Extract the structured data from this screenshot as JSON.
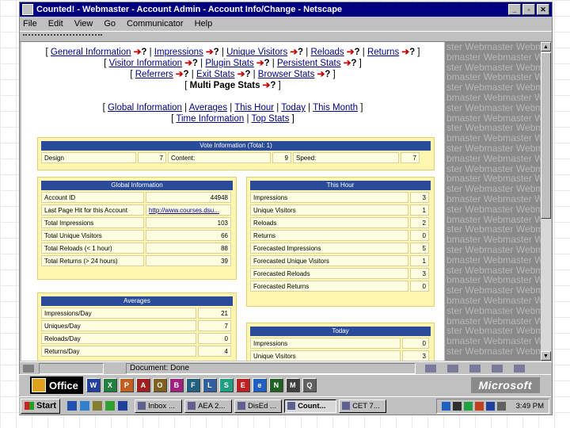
{
  "window": {
    "title": "Counted! - Webmaster - Account Admin - Account Info/Change - Netscape",
    "min_icon": "minimize-icon",
    "max_icon": "maximize-icon",
    "close_icon": "close-icon"
  },
  "menubar": [
    "File",
    "Edit",
    "View",
    "Go",
    "Communicator",
    "Help"
  ],
  "nav": {
    "row1": [
      "General Information",
      "Impressions",
      "Unique Visitors",
      "Reloads",
      "Returns"
    ],
    "row2": [
      "Visitor Information",
      "Plugin Stats",
      "Persistent Stats"
    ],
    "row3": [
      "Referrers",
      "Exit Stats",
      "Browser Stats"
    ],
    "row4_current": "Multi Page Stats",
    "row5": [
      "Global Information",
      "Averages",
      "This Hour",
      "Today",
      "This Month"
    ],
    "row6": [
      "Time Information",
      "Top Stats"
    ]
  },
  "vote": {
    "header": "Vote Information (Total: 1)",
    "cells": [
      {
        "label": "Design",
        "value": "7"
      },
      {
        "label": "Content:",
        "value": "9"
      },
      {
        "label": "Speed:",
        "value": "7"
      }
    ]
  },
  "global_info": {
    "header": "Global Information",
    "rows": [
      {
        "label": "Account ID",
        "value": "44948"
      },
      {
        "label": "Last Page Hit for this Account",
        "value": "http://www.courses.dsu..."
      },
      {
        "label": "Total Impressions",
        "value": "103"
      },
      {
        "label": "Total Unique Visitors",
        "value": "66"
      },
      {
        "label": "Total Reloads (< 1 hour)",
        "value": "88"
      },
      {
        "label": "Total Returns (> 24 hours)",
        "value": "39"
      }
    ]
  },
  "this_hour": {
    "header": "This Hour",
    "rows": [
      {
        "label": "Impressions",
        "value": "3"
      },
      {
        "label": "Unique Visitors",
        "value": "1"
      },
      {
        "label": "Reloads",
        "value": "2"
      },
      {
        "label": "Returns",
        "value": "0"
      },
      {
        "label": "Forecasted Impressions",
        "value": "5"
      },
      {
        "label": "Forecasted Unique Visitors",
        "value": "1"
      },
      {
        "label": "Forecasted Reloads",
        "value": "3"
      },
      {
        "label": "Forecasted Returns",
        "value": "0"
      }
    ]
  },
  "averages": {
    "header": "Averages",
    "rows": [
      {
        "label": "Impressions/Day",
        "value": "21"
      },
      {
        "label": "Uniques/Day",
        "value": "7"
      },
      {
        "label": "Reloads/Day",
        "value": "0"
      },
      {
        "label": "Returns/Day",
        "value": "4"
      }
    ]
  },
  "today": {
    "header": "Today",
    "rows": [
      {
        "label": "Impressions",
        "value": "0"
      },
      {
        "label": "Unique Visitors",
        "value": "3"
      }
    ]
  },
  "sidebar_watermark": "Webmaster",
  "status": {
    "text": "Document: Done"
  },
  "office": {
    "label": "Office",
    "brand": "Microsoft"
  },
  "taskbar": {
    "start": "Start",
    "tasks": [
      "Inbox ...",
      "AEA 2...",
      "DisEd ...",
      "Count...",
      "CET 7..."
    ],
    "active_task": "Count...",
    "clock": "3:49 PM"
  },
  "colors": {
    "titlebar": "#000080",
    "panel_header": "#2a4a9a",
    "panel_bg": "#fff6b0",
    "link": "#000080",
    "arrow": "#c00000"
  }
}
